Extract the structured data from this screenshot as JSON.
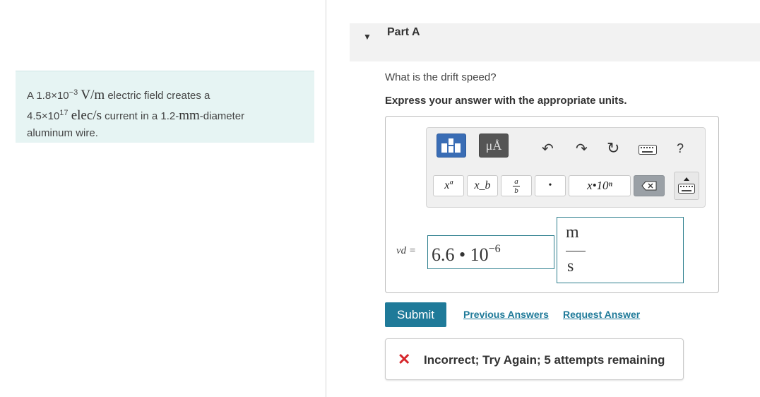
{
  "problem": {
    "text_a": "A 1.8×10",
    "exp_a": "−3",
    "unit_a": "V/m",
    "text_b": "electric field creates a",
    "text_c": "4.5×10",
    "exp_c": "17",
    "unit_c": "elec/s",
    "text_d": "current in a 1.2-",
    "unit_d": "mm",
    "text_e": "-diameter",
    "text_f": "aluminum wire."
  },
  "part": {
    "title": "Part A"
  },
  "question": "What is the drift speed?",
  "instruction": "Express your answer with the appropriate units.",
  "toolbar": {
    "units_label": "μÅ",
    "superscript": "xª",
    "subscript": "x_b",
    "frac_num": "a",
    "frac_den": "b",
    "dot": "•",
    "sci_notation": "x•10ⁿ",
    "help": "?"
  },
  "answer": {
    "variable": "vd =",
    "mantissa": "6.6 • 10",
    "exponent": "−6",
    "unit_num": "m",
    "unit_den": "s"
  },
  "actions": {
    "submit": "Submit",
    "previous": "Previous Answers",
    "request": "Request Answer"
  },
  "feedback": {
    "icon": "✕",
    "message": "Incorrect; Try Again; 5 attempts remaining"
  },
  "colors": {
    "accent": "#1f7a99",
    "error": "#d6262b",
    "problem_bg": "#e6f4f3",
    "field_border": "#2e7f8e"
  }
}
